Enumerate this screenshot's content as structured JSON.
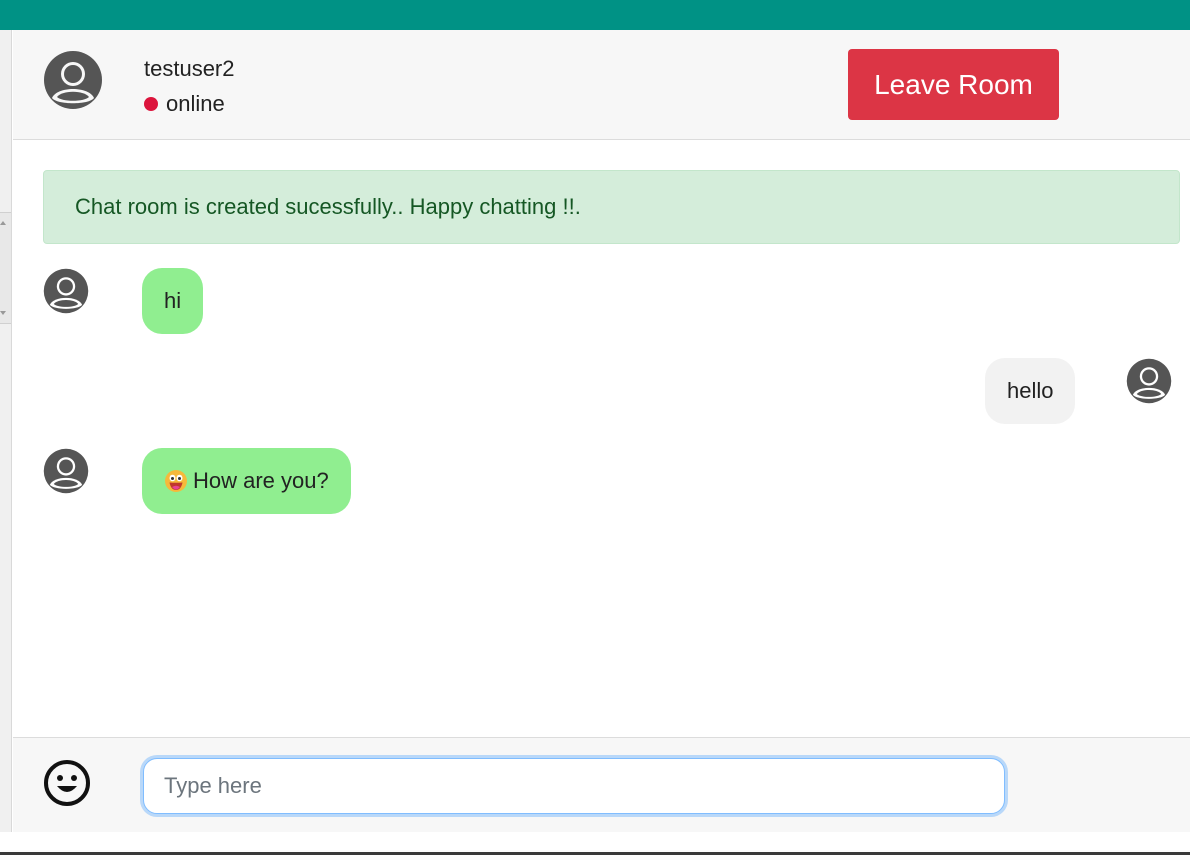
{
  "theme": {
    "topbar_color": "#009285",
    "leave_button_color": "#dc3545",
    "status_dot_color": "#dc143c",
    "incoming_bubble_color": "#90ee90",
    "outgoing_bubble_color": "#f2f2f2",
    "alert_bg_color": "#d4edda",
    "alert_text_color": "#155724"
  },
  "header": {
    "username": "testuser2",
    "status": "online",
    "avatar_icon": "user-avatar-icon",
    "leave_label": "Leave Room"
  },
  "alert": {
    "text": "Chat room is created sucessfully.. Happy chatting !!."
  },
  "messages": [
    {
      "direction": "incoming",
      "text": "hi",
      "avatar_icon": "user-avatar-icon"
    },
    {
      "direction": "outgoing",
      "text": "hello",
      "avatar_icon": "user-avatar-icon"
    },
    {
      "direction": "incoming",
      "emoji": "grinning-face-icon",
      "text": "How are you?",
      "avatar_icon": "user-avatar-icon"
    }
  ],
  "composer": {
    "emoji_icon": "smiley-icon",
    "placeholder": "Type here",
    "value": ""
  }
}
